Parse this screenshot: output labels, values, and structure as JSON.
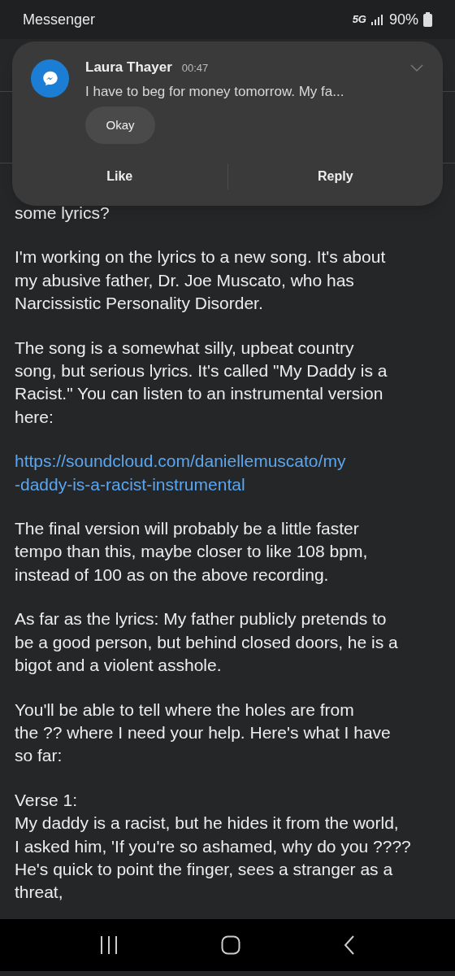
{
  "status_bar": {
    "app": "Messenger",
    "network": "5G",
    "battery": "90%"
  },
  "notification": {
    "sender": "Laura Thayer",
    "time": "00:47",
    "message": "I have to beg for money tomorrow. My fa...",
    "quick_reply": "Okay",
    "actions": [
      "Like",
      "Reply"
    ]
  },
  "body": [
    {
      "kind": "text",
      "lines": [
        "some lyrics?"
      ]
    },
    {
      "kind": "text",
      "lines": [
        "I'm working on the lyrics to a new song. It's about",
        "my abusive father, Dr. Joe Muscato, who has",
        "Narcissistic Personality Disorder."
      ]
    },
    {
      "kind": "text",
      "lines": [
        "The song is a somewhat silly, upbeat country",
        "song, but serious lyrics. It's called \"My Daddy is a",
        "Racist.\" You can listen to an instrumental version",
        "here:"
      ]
    },
    {
      "kind": "link",
      "lines": [
        "https://soundcloud.com/daniellemuscato/my",
        "-daddy-is-a-racist-instrumental"
      ]
    },
    {
      "kind": "text",
      "lines": [
        "The final version will probably be a little faster",
        "tempo than this, maybe closer to like 108 bpm,",
        "instead of 100 as on the above recording."
      ]
    },
    {
      "kind": "text",
      "lines": [
        "As far as the lyrics: My father publicly pretends to",
        "be a good person, but behind closed doors, he is a",
        "bigot and a violent asshole."
      ]
    },
    {
      "kind": "text",
      "lines": [
        "You'll be able to tell where the holes are from",
        "the ?? where I need your help. Here's what I have",
        "so far:"
      ]
    },
    {
      "kind": "text",
      "lines": [
        "Verse 1:",
        "My daddy is a racist, but he hides it from the world,",
        "I asked him, 'If you're so ashamed, why do you ????",
        "He's quick to point the finger, sees a stranger as a",
        "threat,"
      ]
    }
  ]
}
